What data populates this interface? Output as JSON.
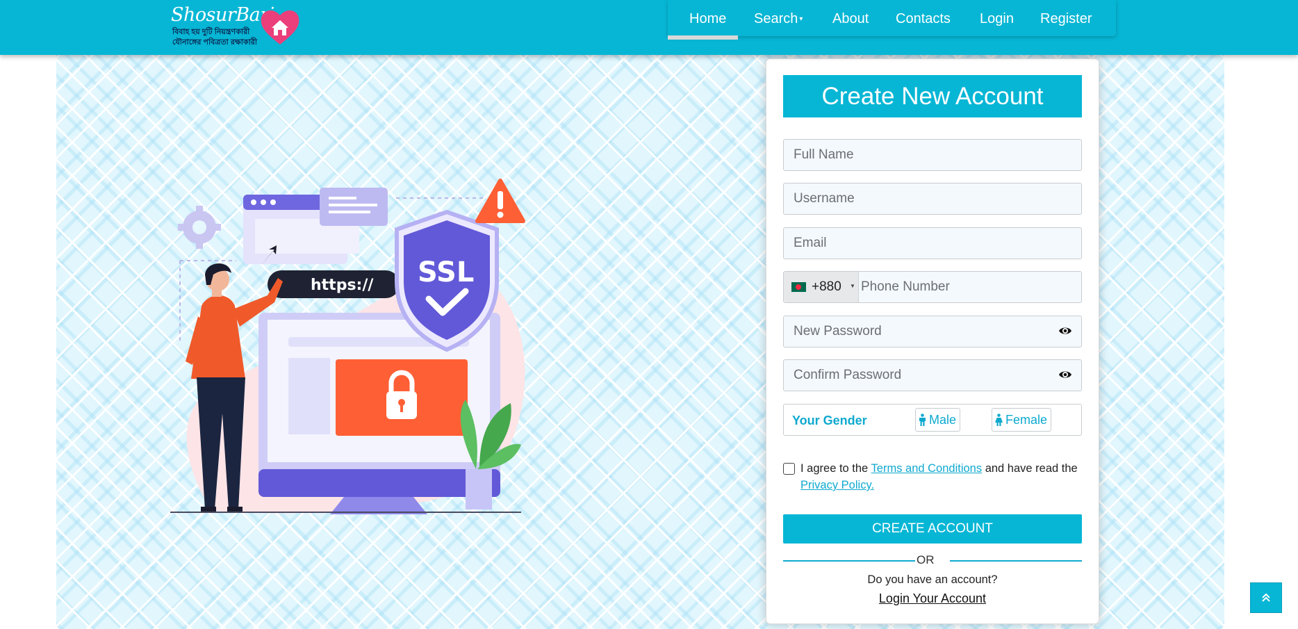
{
  "colors": {
    "brand": "#07b6d5",
    "accent_text": "#0ea9cf",
    "alert": "#ff5f35",
    "shield": "#6259d8"
  },
  "logo": {
    "name": "ShosurBari",
    "tagline_1": "বিবাহ হয় দুটি নিয়ন্ত্রণকারী",
    "tagline_2": "যৌনাঙ্গের পবিত্রতা রক্ষাকারী"
  },
  "nav": {
    "items": [
      {
        "label": "Home",
        "active": true
      },
      {
        "label": "Search",
        "dropdown": true
      },
      {
        "label": "About"
      },
      {
        "label": "Contacts"
      },
      {
        "label": "Login"
      },
      {
        "label": "Register"
      }
    ]
  },
  "illustration": {
    "url_label": "https://",
    "badge_label": "SSL"
  },
  "form": {
    "title": "Create New Account",
    "full_name_placeholder": "Full Name",
    "username_placeholder": "Username",
    "email_placeholder": "Email",
    "phone": {
      "country": "Bangladesh",
      "dial_code": "+880",
      "placeholder": "Phone Number"
    },
    "new_password_placeholder": "New Password",
    "confirm_password_placeholder": "Confirm Password",
    "gender": {
      "label": "Your Gender",
      "male": "Male",
      "female": "Female"
    },
    "agree": {
      "prefix": "I agree to the ",
      "terms": "Terms and Conditions",
      "middle": " and have read the ",
      "privacy": "Privacy Policy",
      "suffix": "."
    },
    "submit": "CREATE ACCOUNT",
    "or": "OR",
    "have_account": "Do you have an account?",
    "login_link": "Login Your Account"
  },
  "back_to_top_icon": "double-chevron-up-icon"
}
